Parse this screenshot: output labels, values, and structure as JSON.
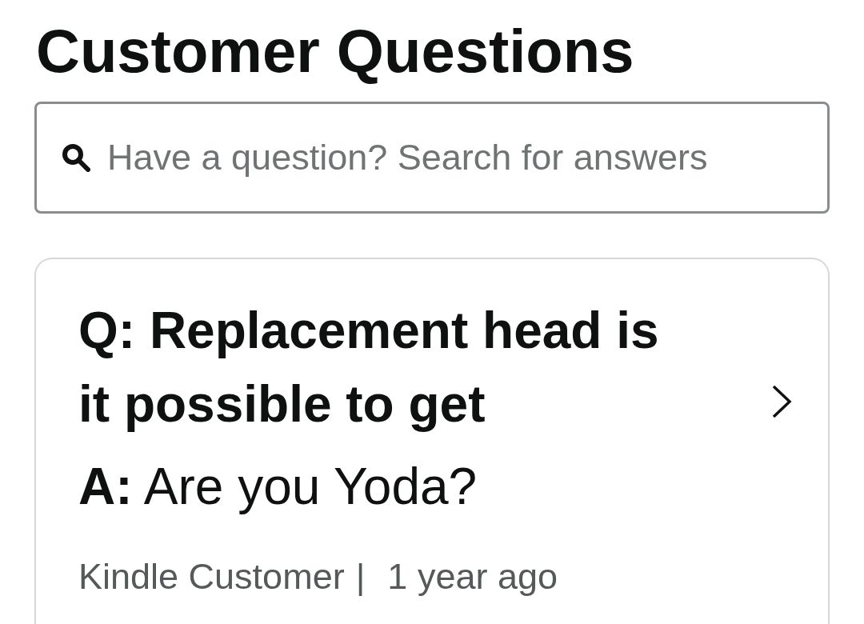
{
  "title": "Customer Questions",
  "search": {
    "placeholder": "Have a question? Search for answers"
  },
  "questions": [
    {
      "question": "Q: Replacement head is it possible to get",
      "answer": "**A:** Are you Yoda?",
      "author": "Kindle Customer",
      "separator": "|",
      "date": "1 year ago"
    }
  ]
}
